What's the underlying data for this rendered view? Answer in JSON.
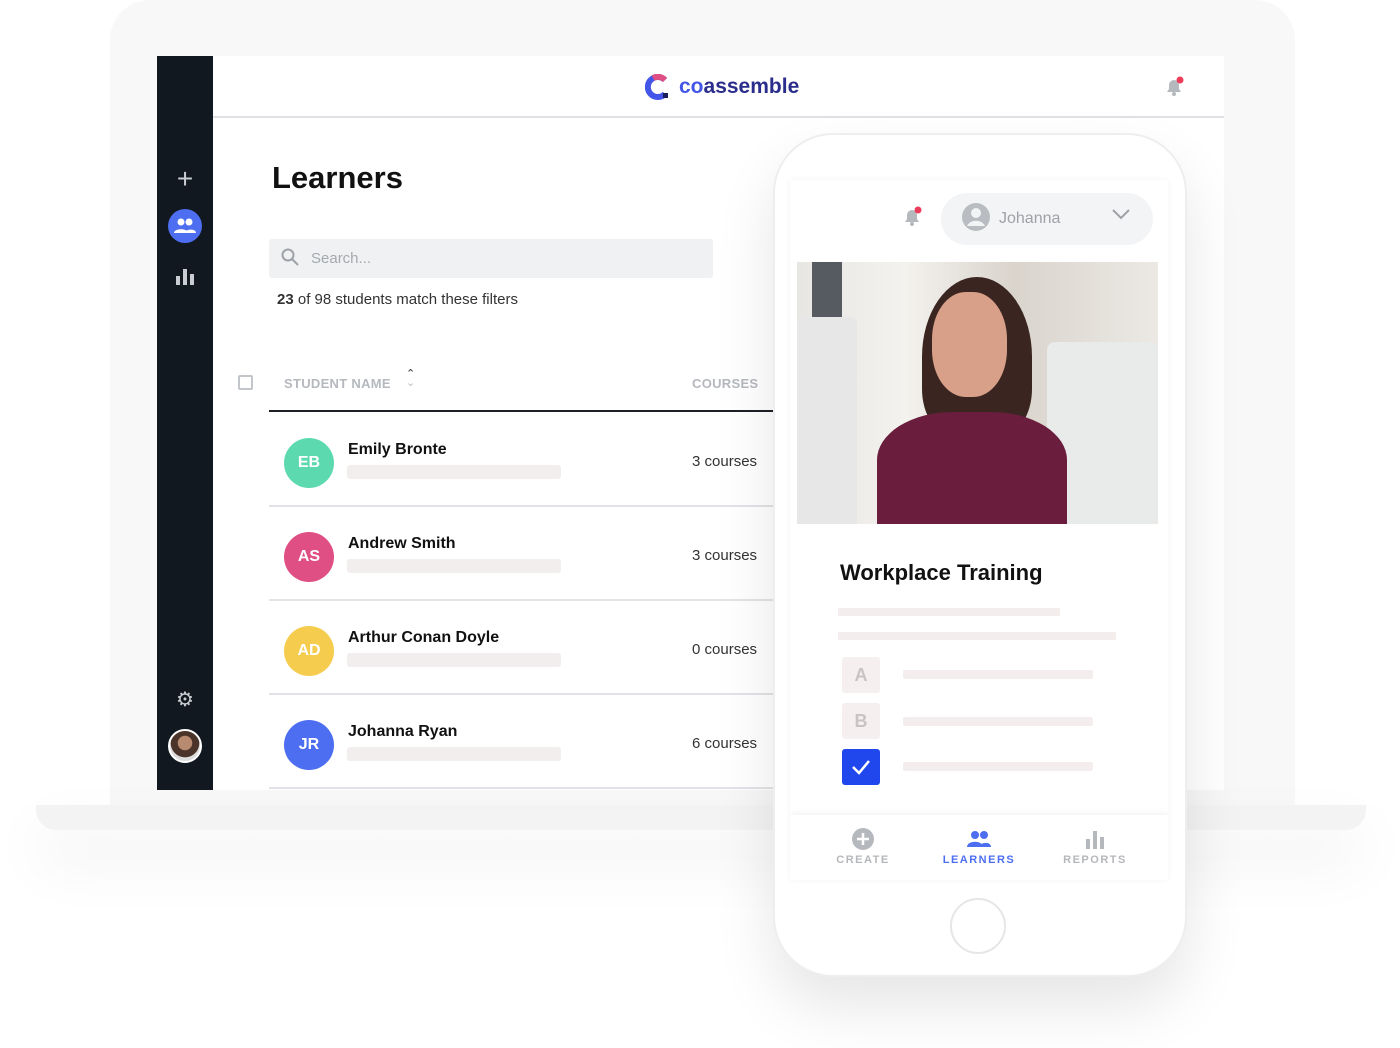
{
  "app": {
    "logo_text_accent": "co",
    "logo_text": "assemble",
    "brand_color": "#4356e8"
  },
  "sidebar": {
    "items": [
      {
        "icon": "plus-icon"
      },
      {
        "icon": "users-icon",
        "active": true
      },
      {
        "icon": "bar-chart-icon"
      },
      {
        "icon": "gear-icon"
      },
      {
        "icon": "avatar"
      }
    ]
  },
  "page": {
    "title": "Learners",
    "search_placeholder": "Search...",
    "count_bold": "23",
    "count_rest": " of 98 students match these filters"
  },
  "table": {
    "headers": {
      "name": "STUDENT NAME",
      "courses": "COURSES"
    },
    "rows": [
      {
        "initials": "EB",
        "name": "Emily Bronte",
        "courses": "3 courses",
        "color": "#5dd9b0"
      },
      {
        "initials": "AS",
        "name": "Andrew Smith",
        "courses": "3 courses",
        "color": "#e04f84"
      },
      {
        "initials": "AD",
        "name": "Arthur Conan Doyle",
        "courses": "0 courses",
        "color": "#f6cc4f"
      },
      {
        "initials": "JR",
        "name": "Johanna Ryan",
        "courses": "6 courses",
        "color": "#4d6ef0"
      }
    ]
  },
  "phone": {
    "user": "Johanna",
    "course_title": "Workplace Training",
    "options": [
      "A",
      "B"
    ],
    "tabs": [
      {
        "label": "CREATE"
      },
      {
        "label": "LEARNERS",
        "active": true
      },
      {
        "label": "REPORTS"
      }
    ]
  }
}
